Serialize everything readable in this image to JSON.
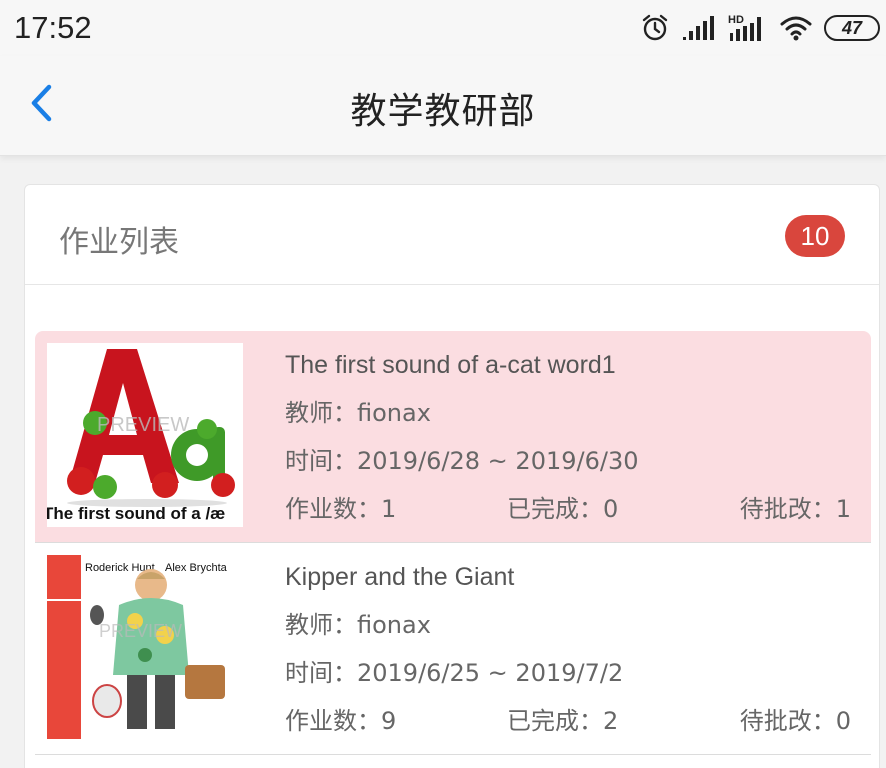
{
  "status_bar": {
    "time": "17:52",
    "battery": "47",
    "icons": [
      "alarm-icon",
      "signal-icon",
      "hd-signal-icon",
      "wifi-icon",
      "battery-icon"
    ]
  },
  "nav": {
    "title": "教学教研部",
    "back_icon": "chevron-left-icon"
  },
  "card": {
    "title": "作业列表",
    "badge_count": "10"
  },
  "homework": [
    {
      "title": "The first sound of a-cat word1",
      "teacher": "教师：fionax",
      "time": "时间：2019/6/28 ~ 2019/6/30",
      "count": "作业数：1",
      "completed": "已完成：0",
      "pending": "待批改：1",
      "thumb_caption": "The first sound of a /æ",
      "thumb_watermark": "PREVIEW",
      "selected": true
    },
    {
      "title": "Kipper and the Giant",
      "teacher": "教师：fionax",
      "time": "时间：2019/6/25 ~ 2019/7/2",
      "count": "作业数：9",
      "completed": "已完成：2",
      "pending": "待批改：0",
      "thumb_author1": "Roderick Hunt",
      "thumb_author2": "Alex Brychta",
      "thumb_watermark": "PREVIEW",
      "selected": false
    }
  ],
  "colors": {
    "accent": "#1a7fe6",
    "badge": "#d9463d",
    "selected_row": "#fbdde1"
  }
}
